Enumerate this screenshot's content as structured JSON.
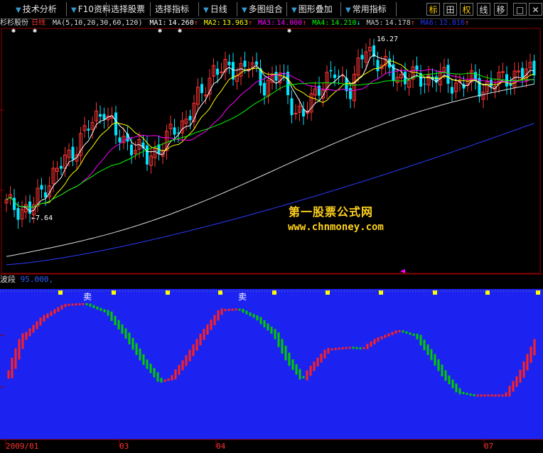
{
  "toolbar": {
    "buttons": [
      {
        "label": "技术分析",
        "arrow": true
      },
      {
        "label": "F10资料",
        "arrow": true
      },
      {
        "label": "选择股票",
        "arrow": false
      },
      {
        "label": "选择指标",
        "arrow": false
      },
      {
        "label": "日线",
        "arrow": true
      },
      {
        "label": "多图组合",
        "arrow": true
      },
      {
        "label": "图形叠加",
        "arrow": true
      },
      {
        "label": "常用指标",
        "arrow": true
      }
    ],
    "tools": [
      "标",
      "田",
      "权",
      "线",
      "移"
    ],
    "icons": {
      "window": "□",
      "close": "✕"
    }
  },
  "stock": {
    "name": "杉杉股份",
    "period": "日线",
    "ma_params": "MA(5,10,20,30,60,120)"
  },
  "ma_values": [
    {
      "label": "MA1:",
      "value": "14.260",
      "arrow": "↑",
      "color": "#ffffff"
    },
    {
      "label": "MA2:",
      "value": "13.963",
      "arrow": "↑",
      "color": "#ffff00"
    },
    {
      "label": "MA3:",
      "value": "14.000",
      "arrow": "↑",
      "color": "#ff00ff"
    },
    {
      "label": "MA4:",
      "value": "14.210",
      "arrow": "↓",
      "color": "#00ff00"
    },
    {
      "label": "MA5:",
      "value": "14.178",
      "arrow": "↑",
      "color": "#cccccc"
    },
    {
      "label": "MA6:",
      "value": "12.816",
      "arrow": "↑",
      "color": "#2233ff"
    }
  ],
  "annotations": {
    "low_price": "7.64",
    "high_price": "16.27",
    "sell_label": "卖"
  },
  "watermark": {
    "line1": "第一股票公式网",
    "line2": "www.chnmoney.com"
  },
  "indicator": {
    "name": "波段",
    "value": "95.000,"
  },
  "date_axis": [
    "2009/01",
    "03",
    "04",
    "07"
  ],
  "colors": {
    "up": "#ff3333",
    "down": "#00e5ff",
    "indicator_bg": "#1c23f0",
    "indicator_up": "#ff2020",
    "indicator_down": "#00cc00",
    "marker": "#ffff00"
  },
  "chart_data": {
    "type": "line",
    "x": [
      "2009/01",
      "03",
      "04",
      "07"
    ],
    "series": [
      {
        "name": "MA1",
        "values": [
          14.26
        ]
      },
      {
        "name": "MA2",
        "values": [
          13.963
        ]
      },
      {
        "name": "MA3",
        "values": [
          14.0
        ]
      },
      {
        "name": "MA4",
        "values": [
          14.21
        ]
      },
      {
        "name": "MA5",
        "values": [
          14.178
        ]
      },
      {
        "name": "MA6",
        "values": [
          12.816
        ]
      }
    ]
  }
}
